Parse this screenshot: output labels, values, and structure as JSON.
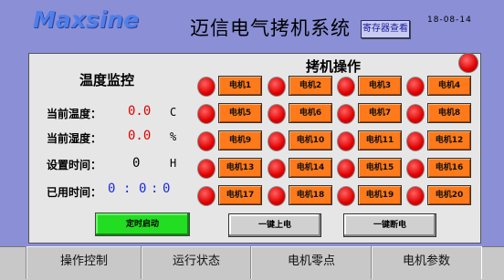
{
  "header": {
    "logo_text": "Maxsine",
    "title": "迈信电气拷机系统",
    "register_button": "寄存器查看",
    "date": "18-08-14"
  },
  "temperature_monitor": {
    "heading": "温度监控",
    "current_temp": {
      "label": "当前温度：",
      "value": "0.0",
      "unit": "C"
    },
    "current_humidity": {
      "label": "当前湿度：",
      "value": "0.0",
      "unit": "%"
    },
    "set_time": {
      "label": "设置时间：",
      "value": "0",
      "unit": "H"
    },
    "elapsed_time": {
      "label": "已用时间：",
      "h": "0",
      "m": "0",
      "s": "0",
      "sep": ":"
    },
    "start_button": "定时启动"
  },
  "motor_operation": {
    "heading": "拷机操作",
    "motors": [
      "电机1",
      "电机2",
      "电机3",
      "电机4",
      "电机5",
      "电机6",
      "电机7",
      "电机8",
      "电机9",
      "电机10",
      "电机11",
      "电机12",
      "电机13",
      "电机14",
      "电机15",
      "电机16",
      "电机17",
      "电机18",
      "电机19",
      "电机20"
    ],
    "power_on_button": "一键上电",
    "power_off_button": "一键断电"
  },
  "tabs": [
    "操作控制",
    "运行状态",
    "电机零点",
    "电机参数"
  ],
  "colors": {
    "background": "#8a8fd6",
    "panel": "#e6e6e6",
    "led_red": "#e00000",
    "motor_button": "#ff7a1a",
    "start_green": "#22dd22",
    "value_red": "#e00000",
    "value_blue": "#1a2ae0"
  }
}
